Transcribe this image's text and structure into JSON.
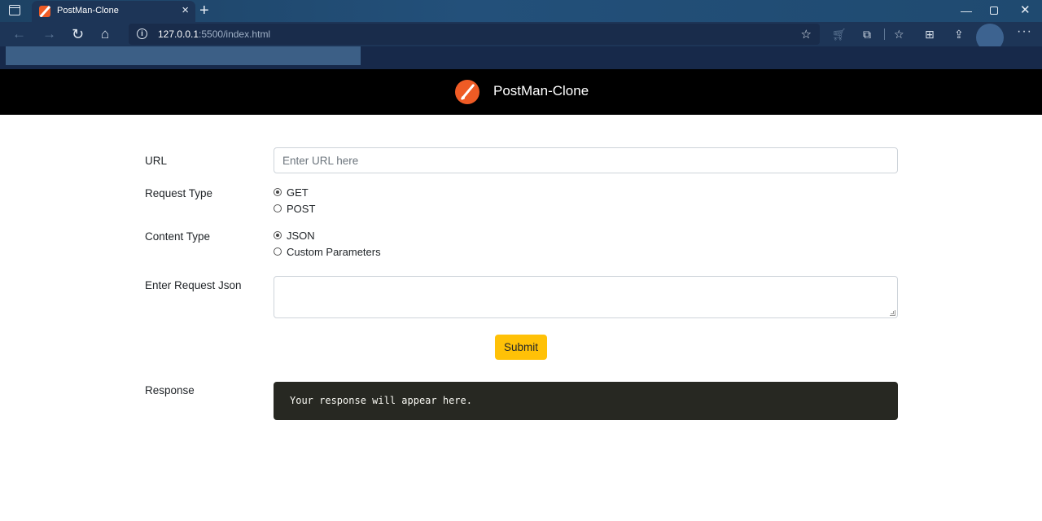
{
  "browser": {
    "tab_title": "PostMan-Clone",
    "url_host": "127.0.0.1",
    "url_rest": ":5500/index.html",
    "tab_close_glyph": "×",
    "new_tab_glyph": "+",
    "icons": [
      "tab-actions-icon",
      "favicon",
      "back-icon",
      "forward-icon",
      "reload-icon",
      "home-icon",
      "site-info-icon",
      "add-favorite-icon",
      "shopping-icon",
      "extensions-icon",
      "favorites-icon",
      "collections-icon",
      "share-icon",
      "profile-avatar",
      "more-icon"
    ]
  },
  "header": {
    "brand": "PostMan-Clone",
    "logo_color": "#ef5b25",
    "background": "#000000"
  },
  "form": {
    "url_label": "URL",
    "url_placeholder": "Enter URL here",
    "url_value": "",
    "request_type_label": "Request Type",
    "request_types": [
      {
        "label": "GET",
        "checked": true
      },
      {
        "label": "POST",
        "checked": false
      }
    ],
    "content_type_label": "Content Type",
    "content_types": [
      {
        "label": "JSON",
        "checked": true
      },
      {
        "label": "Custom Parameters",
        "checked": false
      }
    ],
    "json_label": "Enter Request Json",
    "json_value": "",
    "submit_label": "Submit",
    "submit_color": "#ffc107"
  },
  "response": {
    "label": "Response",
    "text": "Your response will appear here.",
    "background": "#272822"
  }
}
